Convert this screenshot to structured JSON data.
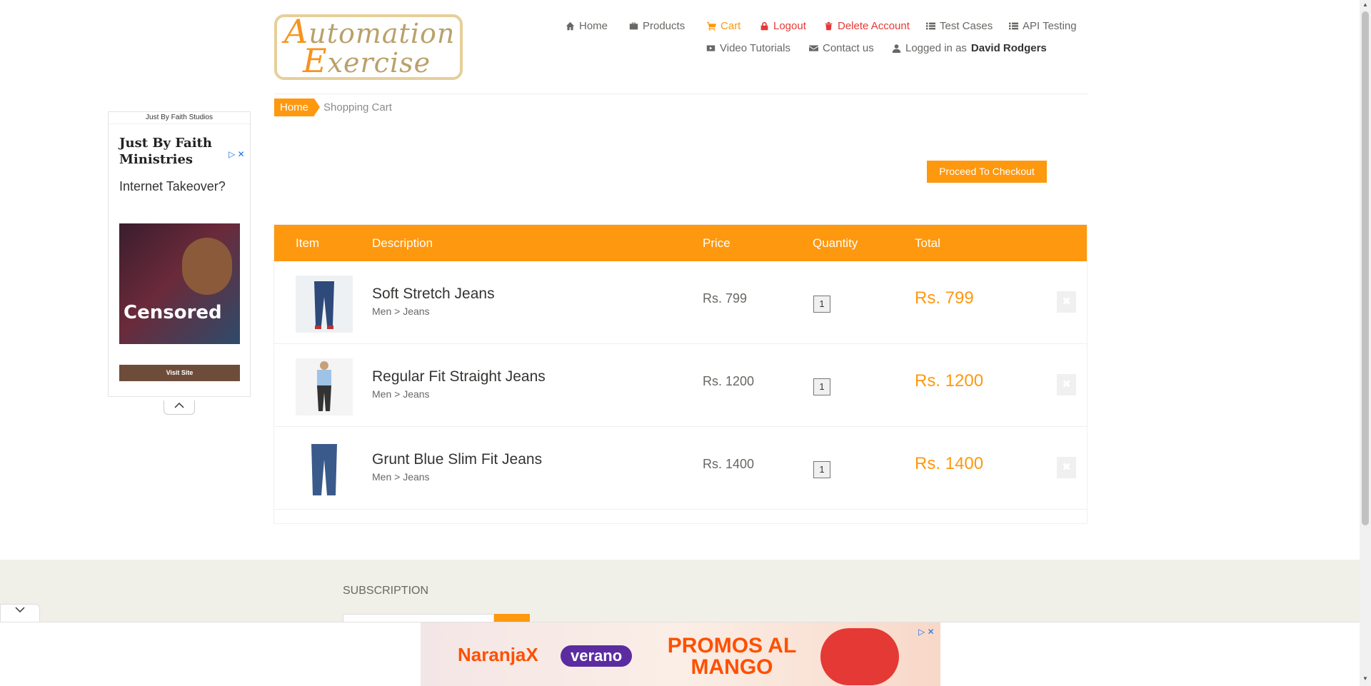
{
  "brand": {
    "logo_line1_cap": "A",
    "logo_line1_rest": "utomation",
    "logo_line2_cap": "E",
    "logo_line2_rest": "xercise"
  },
  "nav": {
    "home": "Home",
    "products": "Products",
    "cart": "Cart",
    "logout": "Logout",
    "delete_account": "Delete Account",
    "test_cases": "Test Cases",
    "api_testing": "API Testing",
    "video_tutorials": "Video Tutorials",
    "contact_us": "Contact us",
    "logged_in_prefix": "Logged in as",
    "username": "David Rodgers"
  },
  "breadcrumb": {
    "home": "Home",
    "current": "Shopping Cart"
  },
  "checkout_label": "Proceed To Checkout",
  "cart": {
    "headers": {
      "item": "Item",
      "description": "Description",
      "price": "Price",
      "quantity": "Quantity",
      "total": "Total"
    },
    "rows": [
      {
        "name": "Soft Stretch Jeans",
        "category": "Men > Jeans",
        "price": "Rs. 799",
        "quantity": "1",
        "total": "Rs. 799"
      },
      {
        "name": "Regular Fit Straight Jeans",
        "category": "Men > Jeans",
        "price": "Rs. 1200",
        "quantity": "1",
        "total": "Rs. 1200"
      },
      {
        "name": "Grunt Blue Slim Fit Jeans",
        "category": "Men > Jeans",
        "price": "Rs. 1400",
        "quantity": "1",
        "total": "Rs. 1400"
      }
    ],
    "delete_glyph": "✖"
  },
  "footer": {
    "subscription_title": "SUBSCRIPTION"
  },
  "side_ad": {
    "studio": "Just By Faith Studios",
    "brand": "Just By Faith Ministries",
    "headline": "Internet Takeover?",
    "image_caption": "Censored",
    "cta": "Visit Site",
    "ad_marker": "▷ ✕"
  },
  "bottom_ad": {
    "brand": "NaranjaX",
    "badge": "verano",
    "promo": "PROMOS AL MANGO",
    "ad_marker": "▷ ✕"
  },
  "colors": {
    "accent": "#fe980f",
    "danger": "#e53935",
    "text": "#696763"
  }
}
